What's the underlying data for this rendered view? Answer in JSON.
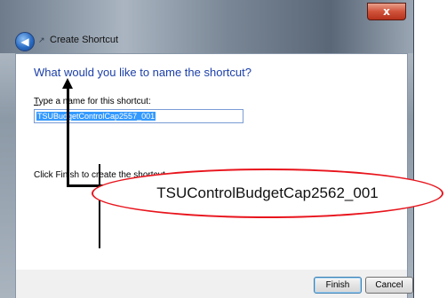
{
  "window": {
    "title": "Create Shortcut",
    "close_label": "x"
  },
  "wizard": {
    "heading": "What would you like to name the shortcut?",
    "name_label_mnemonic": "T",
    "name_label_rest": "ype a name for this shortcut:",
    "name_value": "TSUBudgetControlCap2557_001",
    "hint": "Click Finish to create the shortcut."
  },
  "buttons": {
    "finish": "Finish",
    "cancel": "Cancel"
  },
  "annotation": {
    "callout_text": "TSUControlBudgetCap2562_001",
    "color": "#e8141c"
  }
}
